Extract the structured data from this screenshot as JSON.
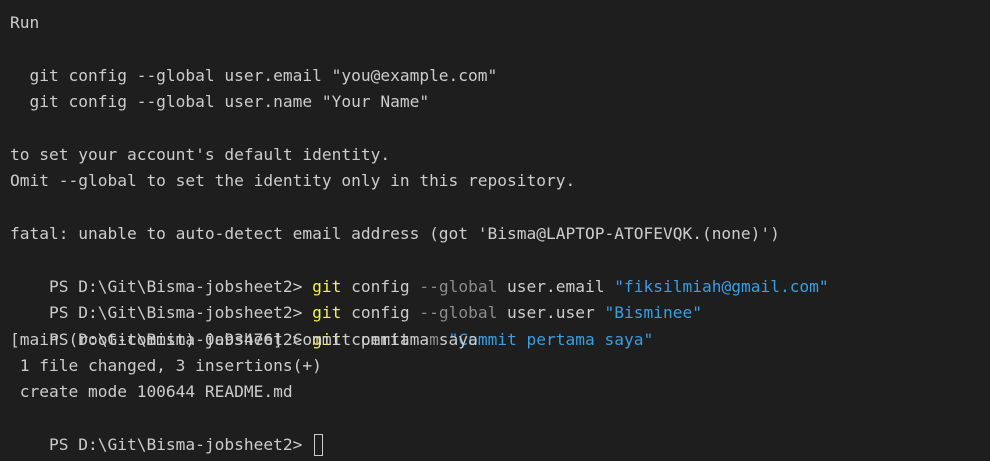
{
  "terminal": {
    "lines": [
      "Run",
      "",
      "  git config --global user.email \"you@example.com\"",
      "  git config --global user.name \"Your Name\"",
      "",
      "to set your account's default identity.",
      "Omit --global to set the identity only in this repository.",
      "",
      "fatal: unable to auto-detect email address (got 'Bisma@LAPTOP-ATOFEVQK.(none)')"
    ],
    "commands": [
      {
        "prompt": "PS D:\\Git\\Bisma-jobsheet2> ",
        "cmd": "git",
        "args": " config ",
        "flag": "--global",
        "rest": " user.email ",
        "str": "\"fiksilmiah@gmail.com\""
      },
      {
        "prompt": "PS D:\\Git\\Bisma-jobsheet2> ",
        "cmd": "git",
        "args": " config ",
        "flag": "--global",
        "rest": " user.user ",
        "str": "\"Bisminee\""
      },
      {
        "prompt": "PS D:\\Git\\Bisma-jobsheet2> ",
        "cmd": "git",
        "args": " commit ",
        "flag": "-m",
        "rest": " ",
        "str": "\"Commit pertama saya\""
      }
    ],
    "output": [
      "[main (root-commit) 0a93476] Commit pertama saya",
      " 1 file changed, 3 insertions(+)",
      " create mode 100644 README.md"
    ],
    "final_prompt": "PS D:\\Git\\Bisma-jobsheet2> ",
    "colors": {
      "background": "#1e1e1e",
      "foreground": "#cccccc",
      "command": "#f5f543",
      "flag": "#8c8c8c",
      "string": "#3b9de2"
    }
  }
}
